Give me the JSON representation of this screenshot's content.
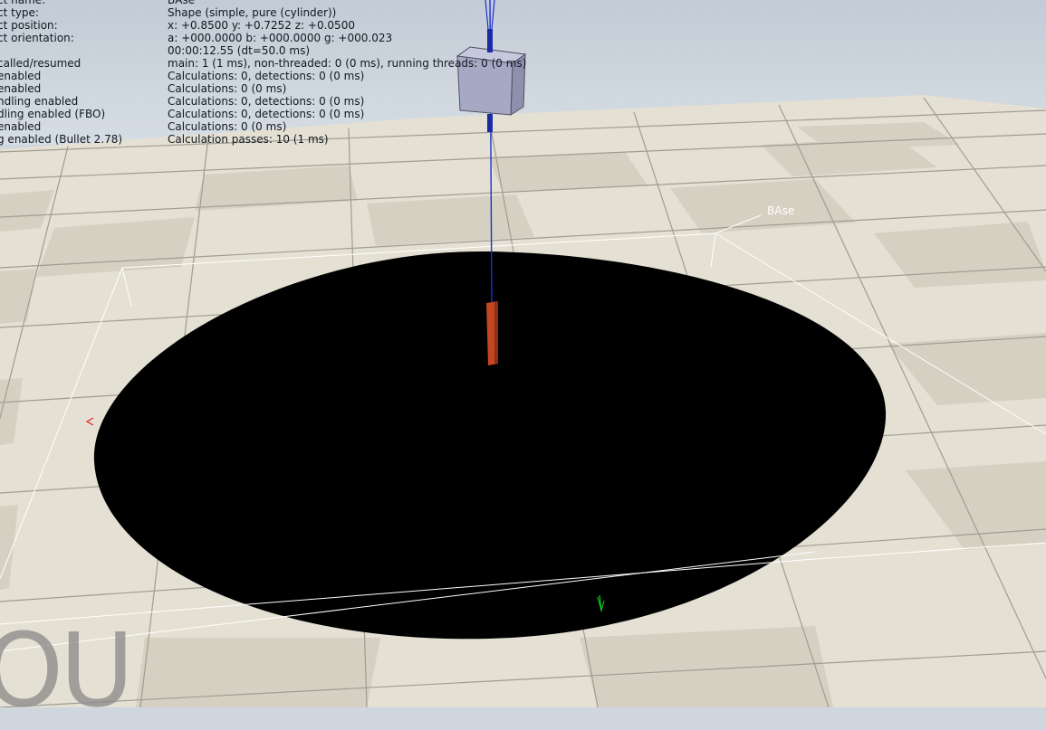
{
  "colors": {
    "sky": "#cdd5dd",
    "tile_light": "#e7e3d6",
    "tile_dark": "#d6d1c2",
    "grid_line": "#9b988f",
    "disk": "#000000",
    "cube": "#a7a9c4",
    "red_post": "#c4461f",
    "axis_blue": "#1f2fd0",
    "axis_red": "#e02020",
    "axis_green": "#10c020",
    "bbox": "#ffffff"
  },
  "info": {
    "rows": [
      {
        "label": "ct name:",
        "value": "BAse"
      },
      {
        "label": "ct type:",
        "value": "Shape (simple, pure (cylinder))"
      },
      {
        "label": "ct position:",
        "value": "x: +0.8500    y: +0.7252    z: +0.0500"
      },
      {
        "label": "ct orientation:",
        "value": "a: +000.0000    b: +000.0000    g: +000.023"
      },
      {
        "label": "",
        "value": "00:00:12.55 (dt=50.0 ms)"
      },
      {
        "label": "called/resumed",
        "value": "main: 1 (1 ms), non-threaded: 0 (0 ms), running threads: 0 (0 ms)"
      },
      {
        "label": "enabled",
        "value": "Calculations: 0, detections: 0 (0 ms)"
      },
      {
        "label": "enabled",
        "value": "Calculations: 0 (0 ms)"
      },
      {
        "label": "ndling enabled",
        "value": "Calculations: 0, detections: 0 (0 ms)"
      },
      {
        "label": "dling enabled (FBO)",
        "value": "Calculations: 0, detections: 0 (0 ms)"
      },
      {
        "label": "enabled",
        "value": "Calculations: 0 (0 ms)"
      },
      {
        "label": "g enabled (Bullet 2.78)",
        "value": "Calculation passes: 10 (1 ms)"
      }
    ]
  },
  "scene": {
    "object_tag": "BAse",
    "watermark": "OU"
  }
}
